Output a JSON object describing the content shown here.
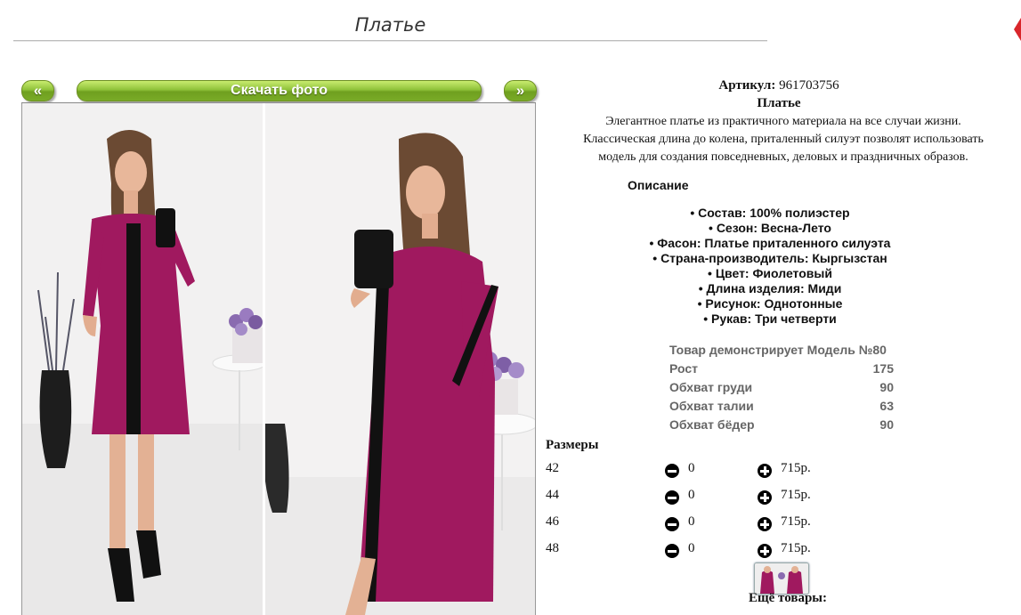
{
  "header": {
    "title": "Платье"
  },
  "gallery": {
    "prev_label": "«",
    "download_label": "Скачать фото",
    "next_label": "»"
  },
  "product": {
    "article_label": "Артикул:",
    "article_value": "961703756",
    "name": "Платье",
    "description_lines": [
      "Элегантное платье из практичного материала на все случаи жизни.",
      "Классическая длина до колена, приталенный силуэт позволят использовать",
      "модель для создания повседневных, деловых и праздничных образов."
    ],
    "spec_heading": "Описание",
    "specs": [
      "• Состав: 100% полиэстер",
      "• Сезон: Весна-Лето",
      "• Фасон: Платье приталенного силуэта",
      "• Страна-производитель: Кыргызстан",
      "• Цвет: Фиолетовый",
      "• Длина изделия: Миди",
      "• Рисунок: Однотонные",
      "• Рукав: Три четверти"
    ],
    "model": [
      {
        "label": "Товар демонстрирует Модель №80",
        "value": ""
      },
      {
        "label": "Рост",
        "value": "175"
      },
      {
        "label": "Обхват груди",
        "value": "90"
      },
      {
        "label": "Обхват талии",
        "value": "63"
      },
      {
        "label": "Обхват бёдер",
        "value": "90"
      }
    ]
  },
  "sizes": {
    "heading": "Размеры",
    "rows": [
      {
        "size": "42",
        "qty": "0",
        "price": "715р."
      },
      {
        "size": "44",
        "qty": "0",
        "price": "715р."
      },
      {
        "size": "46",
        "qty": "0",
        "price": "715р."
      },
      {
        "size": "48",
        "qty": "0",
        "price": "715р."
      }
    ]
  },
  "more": {
    "heading": "Ещё товары:"
  },
  "colors": {
    "button_green": "#8fc23a",
    "dress_magenta": "#a0195f",
    "link_green": "#0a7a0a"
  }
}
